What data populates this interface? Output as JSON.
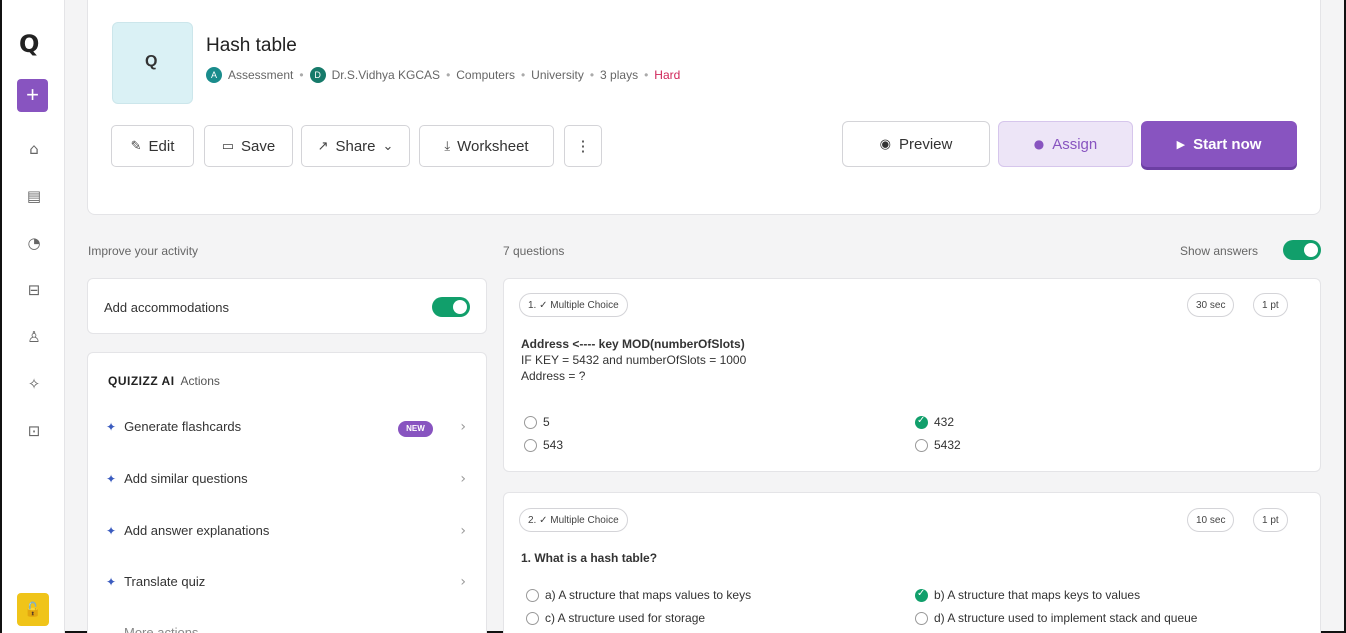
{
  "rail": {
    "logo": "Q",
    "plus": "+",
    "icons": [
      "home-icon",
      "library-icon",
      "reports-icon",
      "classes-icon",
      "certificate-icon",
      "ai-icon",
      "help-icon"
    ],
    "icon_glyphs": [
      "⌂",
      "▤",
      "◔",
      "⊟",
      "♙",
      "✧",
      "⊡"
    ],
    "lock": "🔓"
  },
  "quiz": {
    "thumb_glyph": "Q",
    "title": "Hash table",
    "type": "Assessment",
    "type_icon": "A",
    "author_initial": "D",
    "author": "Dr.S.Vidhya KGCAS",
    "subject": "Computers",
    "level": "University",
    "plays": "3 plays",
    "difficulty": "Hard",
    "sep": "•"
  },
  "toolbar": {
    "edit": "Edit",
    "save": "Save",
    "share": "Share",
    "worksheet": "Worksheet",
    "more": "⋮",
    "preview": "Preview",
    "assign": "Assign",
    "start": "Start now"
  },
  "left": {
    "improve_label": "Improve your activity",
    "accommodations": "Add accommodations",
    "ai_brand": "QUIZIZZ AI",
    "ai_actions": "Actions",
    "new_badge": "NEW",
    "actions": [
      "Generate flashcards",
      "Add similar questions",
      "Add answer explanations",
      "Translate quiz"
    ],
    "more_actions": "More actions"
  },
  "main": {
    "count": "7 questions",
    "show_answers": "Show answers",
    "questions": [
      {
        "label": "1. ✓ Multiple Choice",
        "time": "30 sec",
        "points": "1 pt",
        "line1": "Address <---- key MOD(numberOfSlots)",
        "line2": "IF KEY = 5432 and numberOfSlots = 1000",
        "line3": "Address = ?",
        "options": [
          "5",
          "432",
          "543",
          "5432"
        ]
      },
      {
        "label": "2. ✓ Multiple Choice",
        "time": "10 sec",
        "points": "1 pt",
        "line1": "1. What is a hash table?",
        "options": [
          "a) A structure that maps values to keys",
          "b) A structure that maps keys to values",
          "c) A structure used for storage",
          "d) A structure used to implement stack and queue"
        ]
      }
    ]
  },
  "colors": {
    "accent": "#8854c0",
    "correct": "#119f6b",
    "hard": "#d0275a"
  }
}
